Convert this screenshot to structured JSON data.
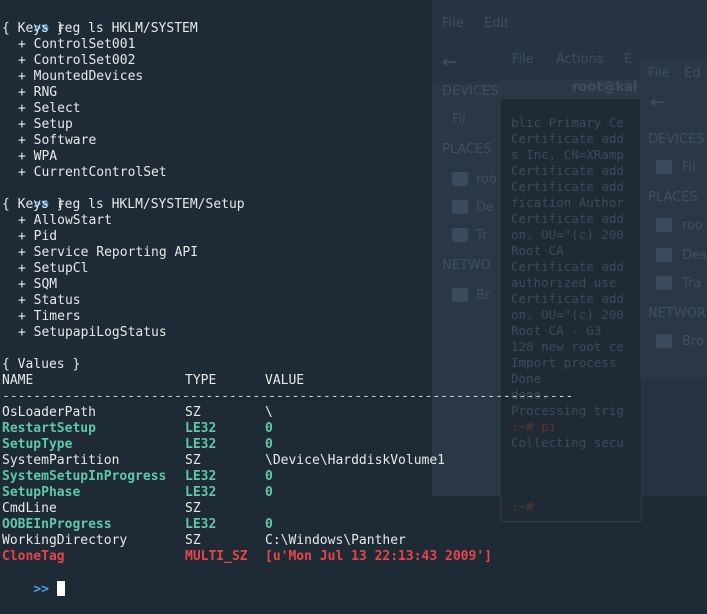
{
  "background": {
    "window1": {
      "items": [
        "File",
        "Edit",
        "DEVICES",
        "Fil",
        "PLACES",
        "roo",
        "De",
        "Tr",
        "NETWO",
        "Br"
      ]
    },
    "window2": {
      "menu": [
        "File",
        "Actions",
        "E"
      ],
      "title": "root@kal",
      "lines": [
        "blic Primary Ce",
        "Certificate add",
        "s Inc, CN=XRamp",
        "Certificate add",
        "Certificate add",
        "fication Author",
        "Certificate add",
        "on, OU=\"(c) 200",
        " Root CA",
        "Certificate add",
        "authorized use",
        "Certificate add",
        "on, OU=\"(c) 200",
        " Root CA - G3",
        "128 new root ce",
        "Import process",
        "Done",
        "done.",
        "Processing trig",
        "      :~# pi",
        "Collecting secu"
      ],
      "last_prompt": "      :~# "
    },
    "window3": {
      "items": [
        "File",
        "Ed",
        "DEVICES",
        "Fil",
        "PLACES",
        "roo",
        "Des",
        "Tra",
        "NETWOR",
        "Bro"
      ]
    }
  },
  "terminal": {
    "prompt": ">>",
    "cmd1": "reg ls HKLM/SYSTEM",
    "keys_header": "{ Keys }",
    "keys1": [
      "ControlSet001",
      "ControlSet002",
      "MountedDevices",
      "RNG",
      "Select",
      "Setup",
      "Software",
      "WPA",
      "CurrentControlSet"
    ],
    "cmd2": "reg ls HKLM/SYSTEM/Setup",
    "keys2": [
      "AllowStart",
      "Pid",
      "Service Reporting API",
      "SetupCl",
      "SQM",
      "Status",
      "Timers",
      "SetupapiLogStatus"
    ],
    "key_prefix": "+ ",
    "values_header": "{ Values }",
    "columns": {
      "name": "NAME",
      "type": "TYPE",
      "value": "VALUE"
    },
    "separator": "-------------------------------------------------------------------------",
    "rows": [
      {
        "name": "OsLoaderPath",
        "type": "SZ",
        "value": "\\",
        "style": "plain"
      },
      {
        "name": "RestartSetup",
        "type": "LE32",
        "value": "0",
        "style": "green"
      },
      {
        "name": "SetupType",
        "type": "LE32",
        "value": "0",
        "style": "green"
      },
      {
        "name": "SystemPartition",
        "type": "SZ",
        "value": "\\Device\\HarddiskVolume1",
        "style": "plain"
      },
      {
        "name": "SystemSetupInProgress",
        "type": "LE32",
        "value": "0",
        "style": "green"
      },
      {
        "name": "SetupPhase",
        "type": "LE32",
        "value": "0",
        "style": "green"
      },
      {
        "name": "CmdLine",
        "type": "SZ",
        "value": "",
        "style": "plain"
      },
      {
        "name": "OOBEInProgress",
        "type": "LE32",
        "value": "0",
        "style": "green"
      },
      {
        "name": "WorkingDirectory",
        "type": "SZ",
        "value": "C:\\Windows\\Panther",
        "style": "plain"
      },
      {
        "name": "CloneTag",
        "type": "MULTI_SZ",
        "value": "[u'Mon Jul 13 22:13:43 2009']",
        "style": "red"
      }
    ],
    "colors": {
      "prompt": "#4aa3df",
      "green": "#5ec9a8",
      "red": "#e8454a",
      "text": "#e8e8e8",
      "background": "#1e2a36"
    }
  }
}
